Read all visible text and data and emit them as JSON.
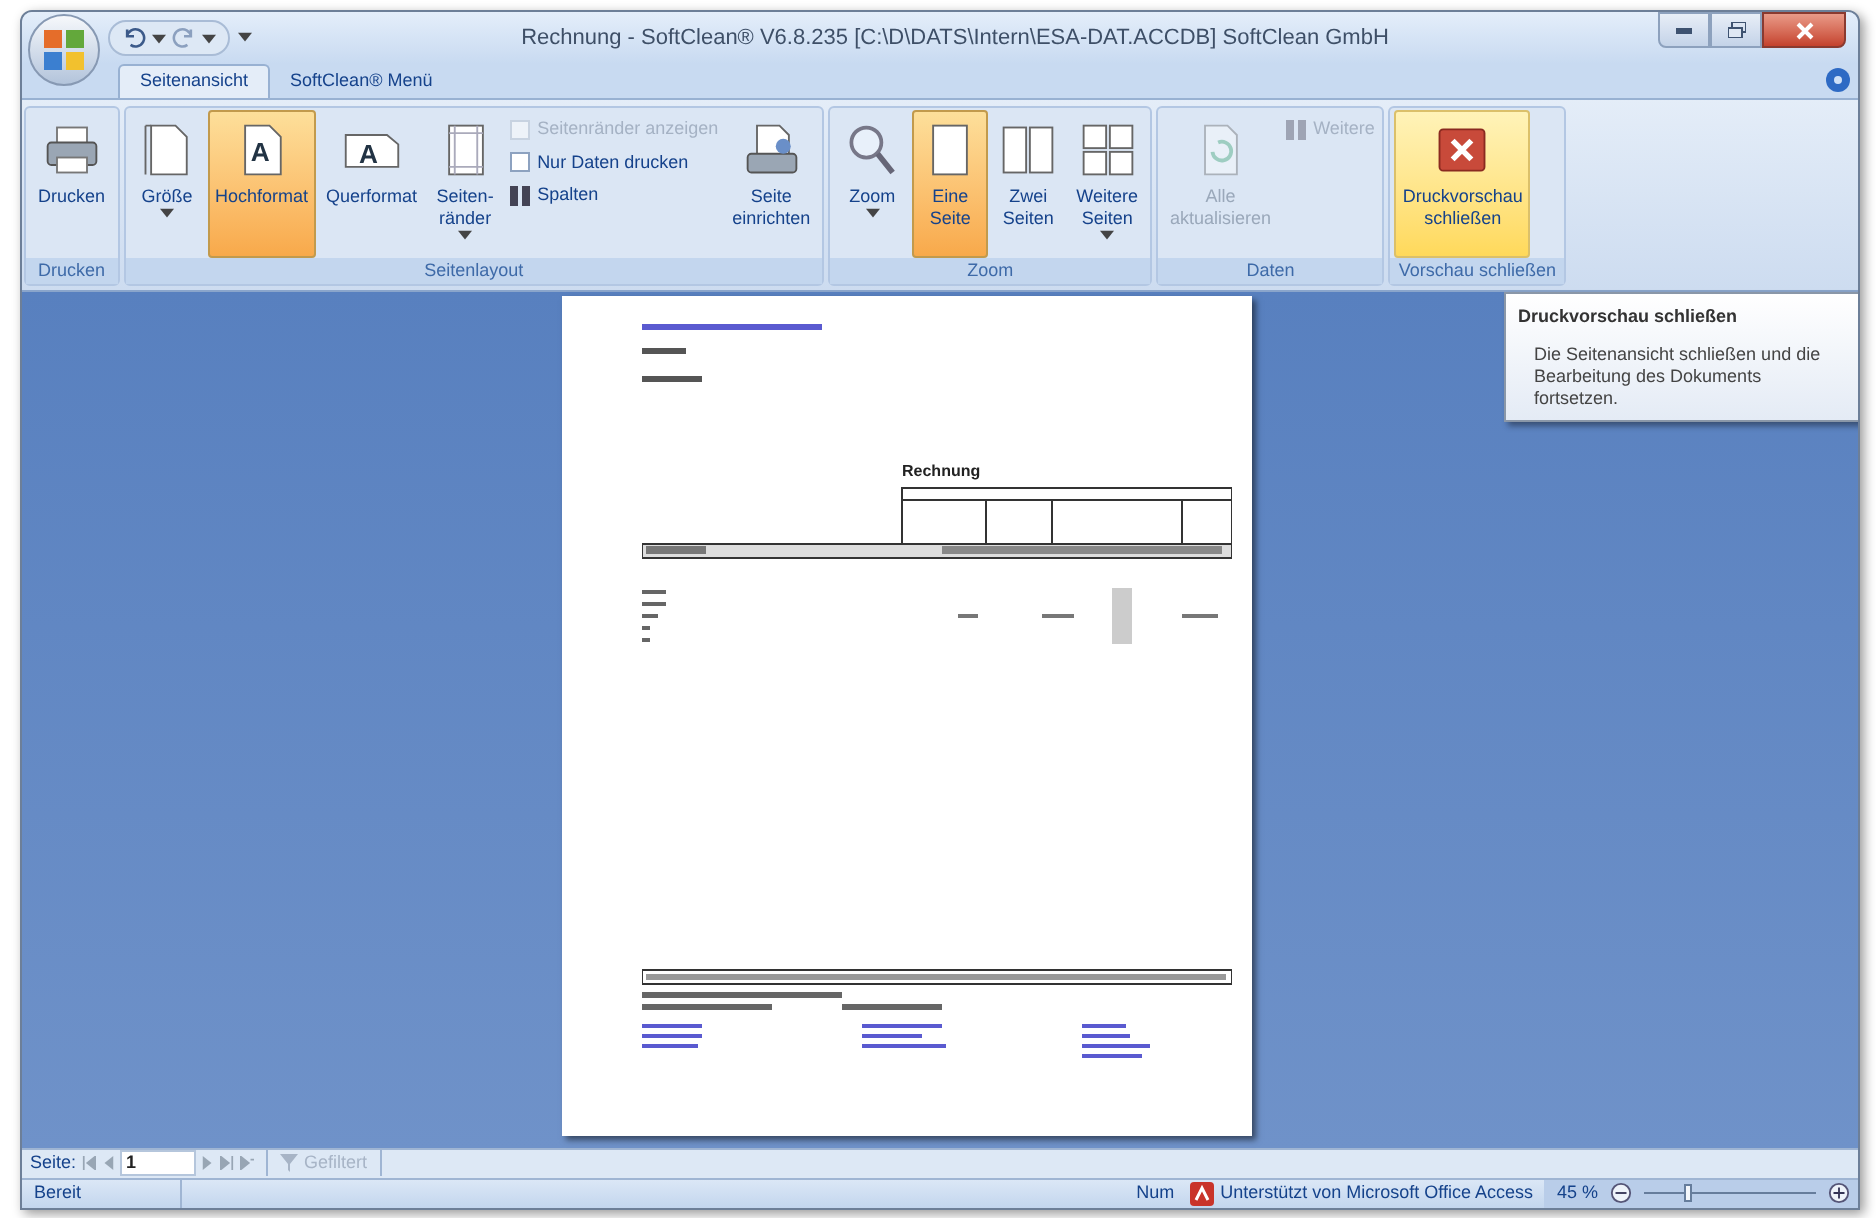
{
  "window": {
    "title": "Rechnung - SoftClean® V6.8.235 [C:\\D\\DATS\\Intern\\ESA-DAT.ACCDB] SoftClean GmbH"
  },
  "tabs": [
    {
      "label": "Seitenansicht",
      "selected": true
    },
    {
      "label": "SoftClean® Menü",
      "selected": false
    }
  ],
  "ribbon_groups": [
    {
      "label": "Drucken",
      "items": [
        {
          "kind": "large",
          "label": "Drucken",
          "dropdown": false,
          "selected": false,
          "hovered": false,
          "disabled": false
        }
      ]
    },
    {
      "label": "Seitenlayout",
      "items": [
        {
          "kind": "large",
          "label": "Größe",
          "dropdown": true,
          "selected": false,
          "hovered": false,
          "disabled": false
        },
        {
          "kind": "large",
          "label": "Hochformat",
          "icon_letter": "A",
          "dropdown": false,
          "selected": true,
          "hovered": false,
          "disabled": false
        },
        {
          "kind": "large",
          "label": "Querformat",
          "icon_letter": "A",
          "dropdown": false,
          "selected": false,
          "hovered": false,
          "disabled": false
        },
        {
          "kind": "large",
          "label": "Seiten-\nränder",
          "dropdown": true,
          "selected": false,
          "hovered": false,
          "disabled": false
        },
        {
          "kind": "stack",
          "rows": [
            {
              "kind": "checkbox",
              "label": "Seitenränder anzeigen",
              "checked": false,
              "disabled": true
            },
            {
              "kind": "checkbox",
              "label": "Nur Daten drucken",
              "checked": false,
              "disabled": false
            },
            {
              "kind": "button",
              "label": "Spalten",
              "disabled": false
            }
          ]
        },
        {
          "kind": "large",
          "label": "Seite\neinrichten",
          "dropdown": false,
          "selected": false,
          "hovered": false,
          "disabled": false
        }
      ]
    },
    {
      "label": "Zoom",
      "items": [
        {
          "kind": "large",
          "label": "Zoom",
          "dropdown": true,
          "selected": false,
          "hovered": false,
          "disabled": false
        },
        {
          "kind": "large",
          "label": "Eine\nSeite",
          "dropdown": false,
          "selected": true,
          "hovered": false,
          "disabled": false
        },
        {
          "kind": "large",
          "label": "Zwei\nSeiten",
          "dropdown": false,
          "selected": false,
          "hovered": false,
          "disabled": false
        },
        {
          "kind": "large",
          "label": "Weitere\nSeiten",
          "dropdown": true,
          "selected": false,
          "hovered": false,
          "disabled": false
        }
      ]
    },
    {
      "label": "Daten",
      "items": [
        {
          "kind": "large",
          "label": "Alle\naktualisieren",
          "dropdown": false,
          "selected": false,
          "hovered": false,
          "disabled": true
        },
        {
          "kind": "stack",
          "rows": [
            {
              "kind": "button",
              "label": "Weitere",
              "disabled": true
            }
          ]
        }
      ]
    },
    {
      "label": "Vorschau schließen",
      "items": [
        {
          "kind": "large",
          "label": "Druckvorschau\nschließen",
          "dropdown": false,
          "selected": false,
          "hovered": true,
          "disabled": false
        }
      ]
    }
  ],
  "document": {
    "heading": "Rechnung"
  },
  "tooltip": {
    "title": "Druckvorschau schließen",
    "text": "Die Seitenansicht schließen und die Bearbeitung des Dokuments fortsetzen."
  },
  "navigation": {
    "label": "Seite:",
    "page": "1",
    "filter": {
      "label": "Gefiltert",
      "disabled": true
    }
  },
  "status_bar": {
    "state": "Bereit",
    "num": "Num",
    "powered_by": "Unterstützt von Microsoft Office Access",
    "zoom": "45 %",
    "zoom_slider": {
      "level": 0.25
    }
  }
}
